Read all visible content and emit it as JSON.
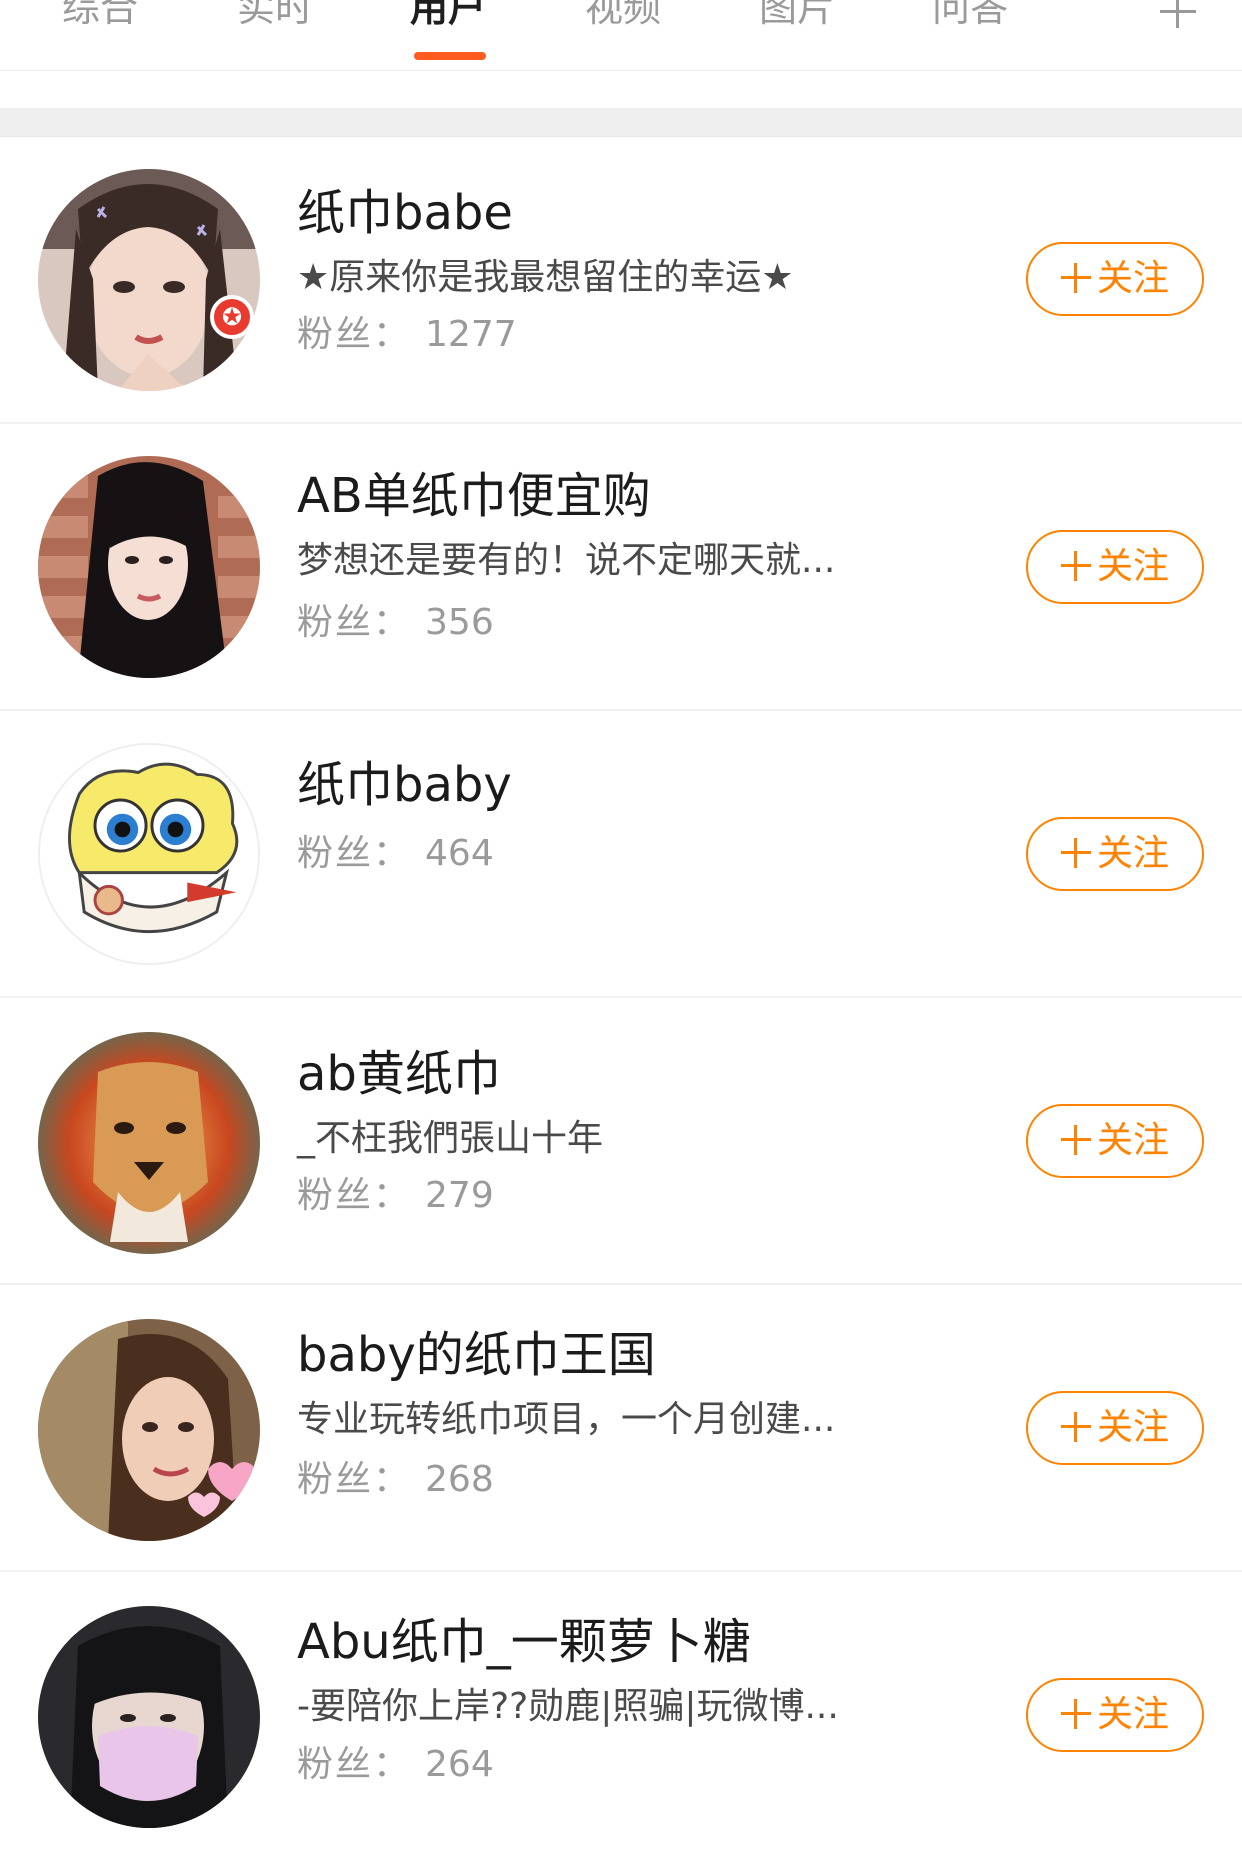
{
  "tabs": [
    {
      "label": "综合",
      "active": false
    },
    {
      "label": "实时",
      "active": false
    },
    {
      "label": "用户",
      "active": true
    },
    {
      "label": "视频",
      "active": false
    },
    {
      "label": "图片",
      "active": false
    },
    {
      "label": "问答",
      "active": false
    }
  ],
  "tabs_more_icon": "plus-icon",
  "accent_color": "#ff5a1f",
  "follow_color": "#ff8200",
  "fans_label": "粉丝：",
  "users": [
    {
      "name": "纸巾babe",
      "desc": "★原来你是我最想留住的幸运★",
      "fans": "1277",
      "follow_label": "关注",
      "has_badge": true,
      "avatar_icon": "girl-photo"
    },
    {
      "name": "AB单纸巾便宜购",
      "desc": "梦想还是要有的！说不定哪天就...",
      "fans": "356",
      "follow_label": "关注",
      "has_badge": false,
      "avatar_icon": "girl-photo-brick-wall"
    },
    {
      "name": "纸巾baby",
      "desc": "",
      "fans": "464",
      "follow_label": "关注",
      "has_badge": false,
      "avatar_icon": "cartoon-sponge"
    },
    {
      "name": "ab黄纸巾",
      "desc": "_不枉我們張山十年",
      "fans": "279",
      "follow_label": "关注",
      "has_badge": false,
      "avatar_icon": "lion-painting"
    },
    {
      "name": "baby的纸巾王国",
      "desc": "专业玩转纸巾项目，一个月创建...",
      "fans": "268",
      "follow_label": "关注",
      "has_badge": false,
      "avatar_icon": "girl-photo-hearts"
    },
    {
      "name": "Abu纸巾_一颗萝卜糖",
      "desc": "-要陪你上岸??勋鹿|照骗|玩微博...",
      "fans": "264",
      "follow_label": "关注",
      "has_badge": false,
      "avatar_icon": "masked-person-photo"
    }
  ]
}
